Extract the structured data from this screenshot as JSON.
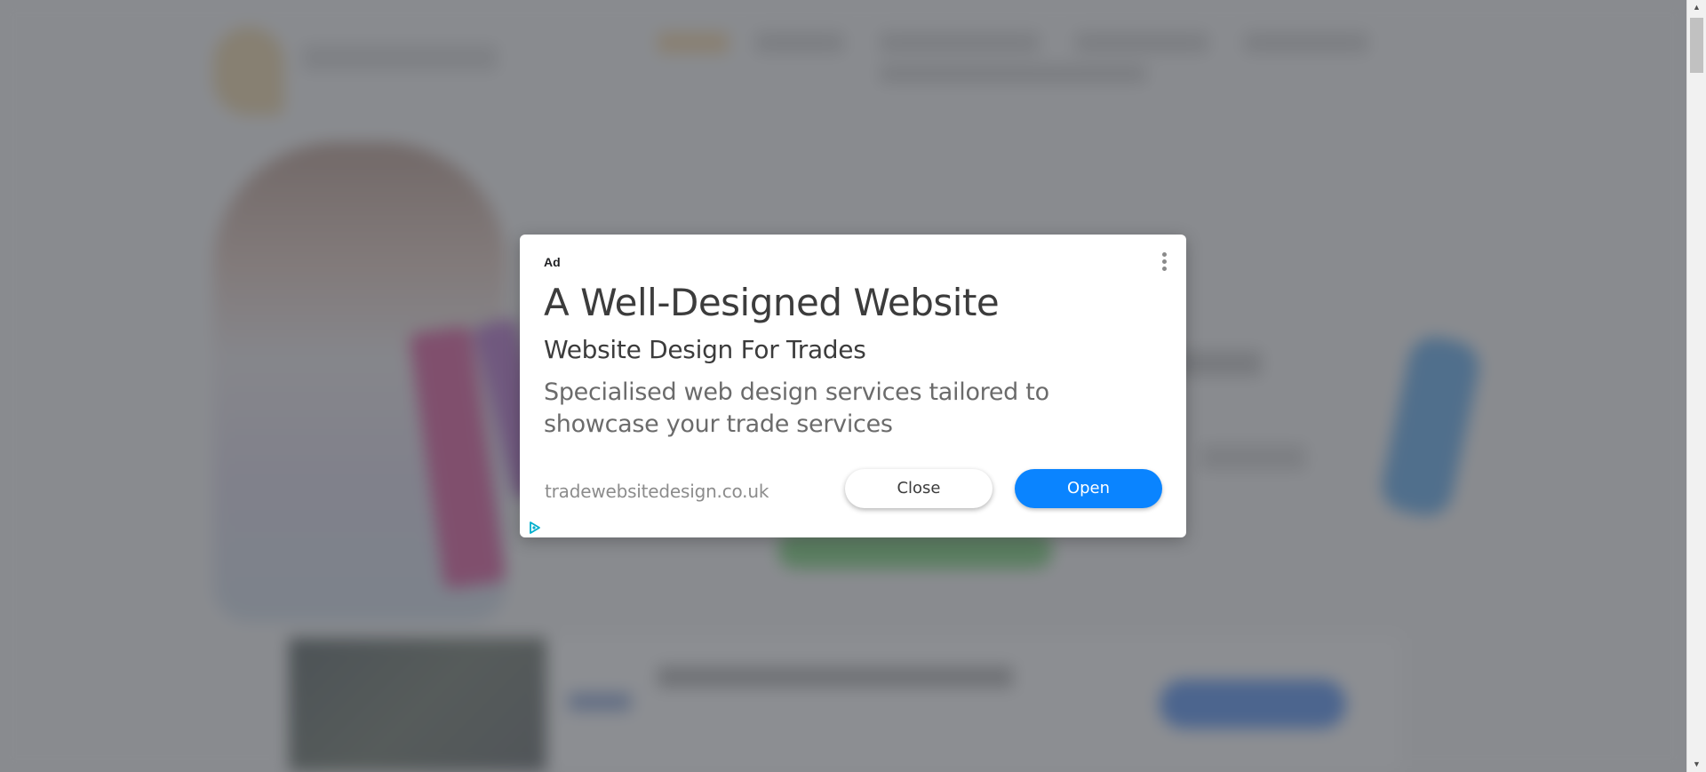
{
  "ad": {
    "label": "Ad",
    "headline": "A Well-Designed Website",
    "subheadline": "Website Design For Trades",
    "description": "Specialised web design services tailored to showcase your trade services",
    "domain": "tradewebsitedesign.co.uk",
    "close_label": "Close",
    "open_label": "Open",
    "menu_icon": "more-vert-icon",
    "adchoices_icon": "adchoices-icon"
  },
  "colors": {
    "open_button": "#0a84ff",
    "overlay": "#5f6368",
    "adchoices": "#00aecd"
  }
}
